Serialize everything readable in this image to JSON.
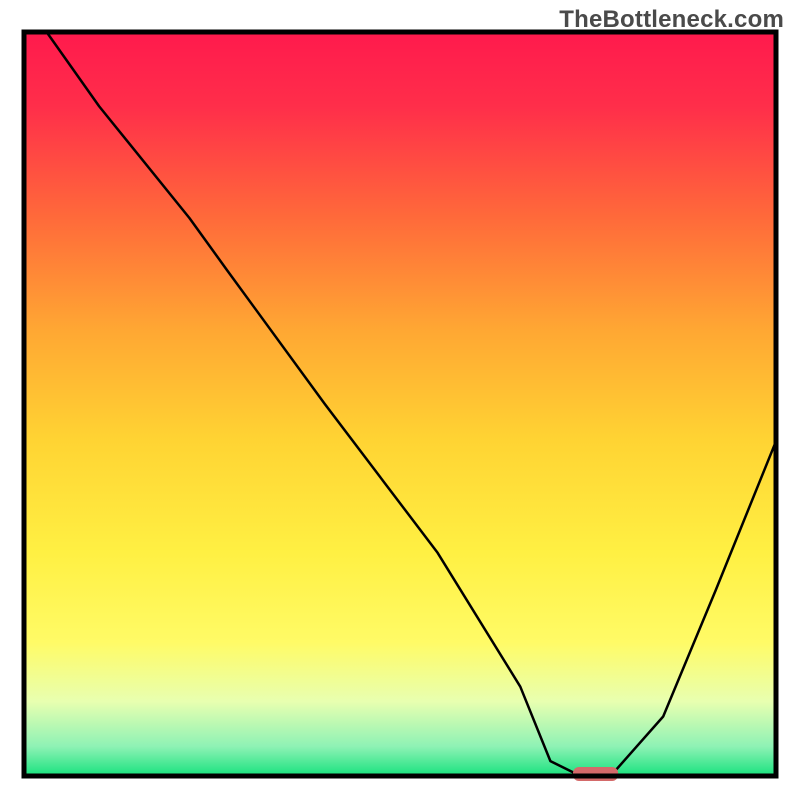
{
  "watermark": "TheBottleneck.com",
  "chart_data": {
    "type": "line",
    "title": "",
    "xlabel": "",
    "ylabel": "",
    "xlim": [
      0,
      100
    ],
    "ylim": [
      0,
      100
    ],
    "axes_visible": false,
    "legend": false,
    "background_gradient_stops": [
      {
        "offset": 0.0,
        "color": "#ff1a4d"
      },
      {
        "offset": 0.1,
        "color": "#ff2e4a"
      },
      {
        "offset": 0.25,
        "color": "#ff6a3a"
      },
      {
        "offset": 0.4,
        "color": "#ffa733"
      },
      {
        "offset": 0.55,
        "color": "#ffd433"
      },
      {
        "offset": 0.7,
        "color": "#fff043"
      },
      {
        "offset": 0.82,
        "color": "#fffb66"
      },
      {
        "offset": 0.9,
        "color": "#e8ffb0"
      },
      {
        "offset": 0.96,
        "color": "#8ff2b5"
      },
      {
        "offset": 1.0,
        "color": "#18e27e"
      }
    ],
    "series": [
      {
        "name": "bottleneck-curve",
        "color": "#000000",
        "stroke_width": 2.5,
        "x": [
          3,
          10,
          22,
          27,
          40,
          55,
          66,
          70,
          74,
          78,
          85,
          92,
          100
        ],
        "values": [
          100,
          90,
          75,
          68,
          50,
          30,
          12,
          2,
          0,
          0,
          8,
          25,
          45
        ]
      }
    ],
    "marker": {
      "name": "optimal-point",
      "x": 76,
      "width": 6,
      "color": "#d46a6a"
    },
    "frame": {
      "color": "#000000",
      "stroke_width": 5
    }
  }
}
